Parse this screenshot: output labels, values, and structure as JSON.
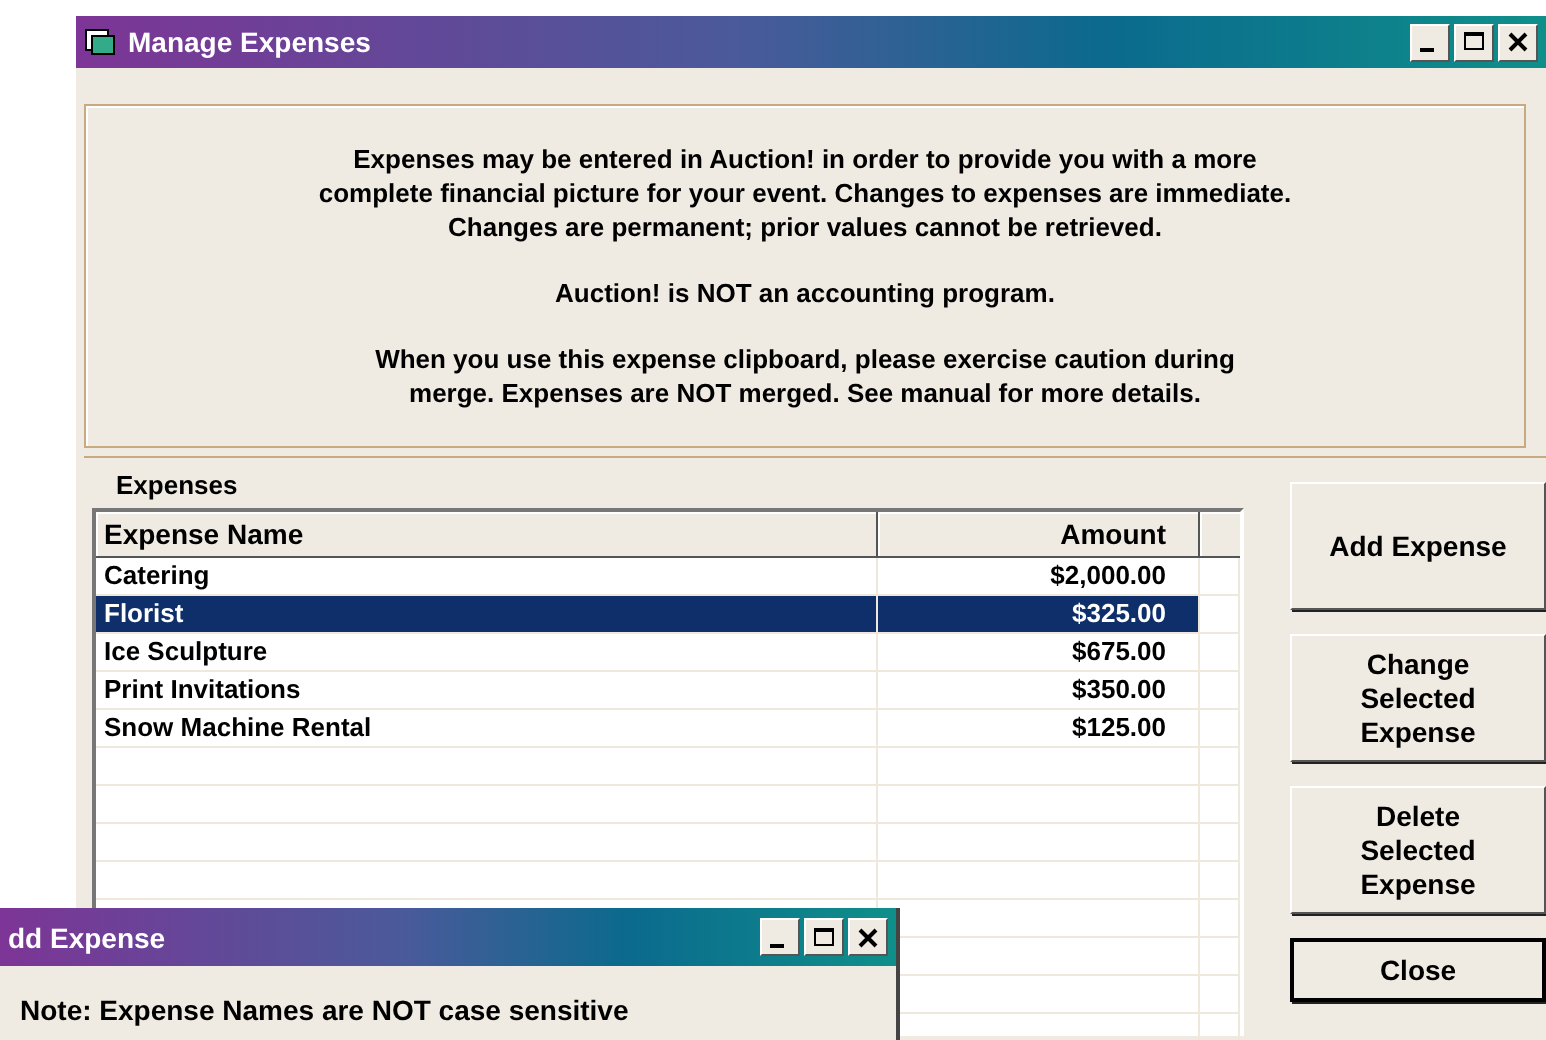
{
  "window": {
    "title": "Manage Expenses"
  },
  "notice": [
    [
      "Expenses may be entered in Auction! in order to provide you with a more",
      "complete financial picture for your event.  Changes to expenses are immediate.",
      "Changes are permanent; prior values cannot be retrieved."
    ],
    [
      "Auction! is NOT an accounting program."
    ],
    [
      "When you use this expense clipboard, please exercise caution during",
      "merge.  Expenses are NOT merged.  See manual for more details."
    ]
  ],
  "expenses_label": "Expenses",
  "table": {
    "columns": [
      "Expense Name",
      "Amount"
    ],
    "rows": [
      {
        "name": "Catering",
        "amount": "$2,000.00",
        "selected": false
      },
      {
        "name": "Florist",
        "amount": "$325.00",
        "selected": true
      },
      {
        "name": "Ice Sculpture",
        "amount": "$675.00",
        "selected": false
      },
      {
        "name": "Print Invitations",
        "amount": "$350.00",
        "selected": false
      },
      {
        "name": "Snow Machine Rental",
        "amount": "$125.00",
        "selected": false
      }
    ]
  },
  "buttons": [
    {
      "label": "Add Expense",
      "kind": "plain"
    },
    {
      "label": "Change Selected Expense",
      "kind": "plain"
    },
    {
      "label": "Delete Selected Expense",
      "kind": "plain"
    },
    {
      "label": "Close",
      "kind": "default"
    }
  ],
  "dialog": {
    "title": "dd Expense",
    "note": "Note:  Expense Names are NOT case sensitive"
  }
}
